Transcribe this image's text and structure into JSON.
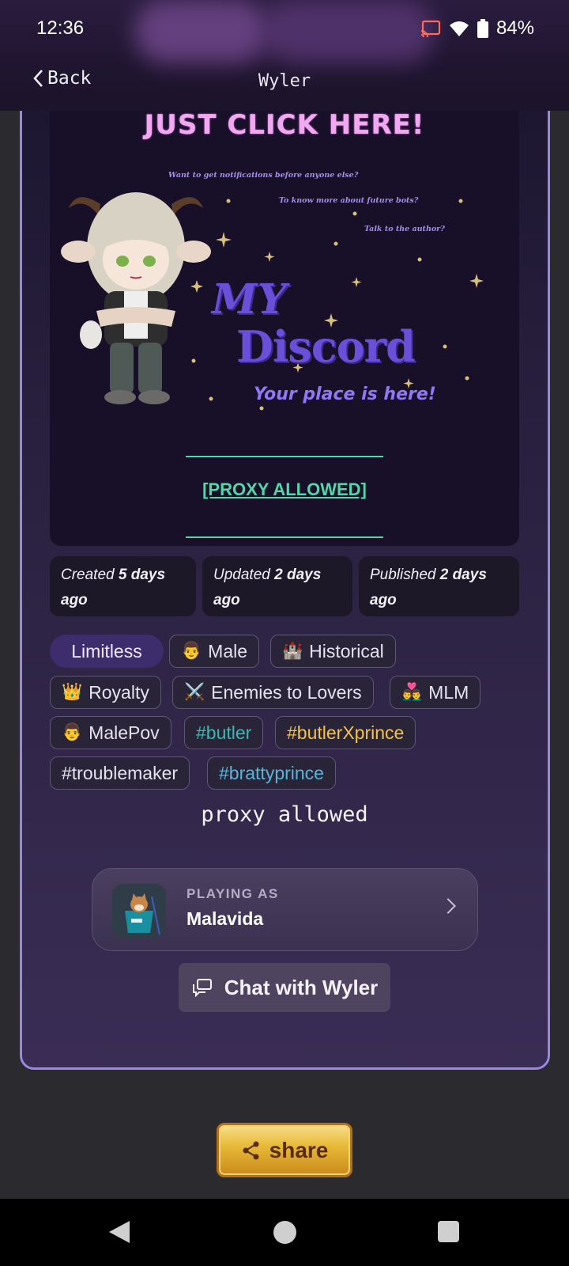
{
  "status_bar": {
    "time": "12:36",
    "battery": "84%"
  },
  "header": {
    "back_label": "Back",
    "title": "Wyler"
  },
  "banner": {
    "headline": "JUST CLICK HERE!",
    "notes": [
      "Want to get notifications before anyone else?",
      "To know more about future bots?",
      "Talk to the author?"
    ],
    "discord_my": "MY",
    "discord_word": "Discord",
    "discord_tag": "Your place is here!",
    "proxy_link": "[PROXY ALLOWED]"
  },
  "meta": [
    {
      "prefix": "Created",
      "value": "5 days",
      "suffix": "ago"
    },
    {
      "prefix": "Updated",
      "value": "2 days",
      "suffix": "ago"
    },
    {
      "prefix": "Published",
      "value": "2 days",
      "suffix": "ago"
    }
  ],
  "tags": {
    "limitless": "Limitless",
    "male": "Male",
    "historical": "Historical",
    "royalty": "Royalty",
    "enemies_to_lovers": "Enemies to Lovers",
    "mlm": "MLM",
    "malepov": "MalePov",
    "butler": "#butler",
    "butlerxprince": "#butlerXprince",
    "troublemaker": "#troublemaker",
    "brattyprince": "#brattyprince"
  },
  "tag_emojis": {
    "male": "👨",
    "historical": "🏰",
    "royalty": "👑",
    "enemies_to_lovers": "⚔️",
    "mlm": "👨‍❤️‍👨",
    "malepov": "👨"
  },
  "caption": "proxy allowed",
  "persona": {
    "label": "PLAYING AS",
    "name": "Malavida"
  },
  "chat_button": "Chat with Wyler",
  "share_button": "share",
  "colors": {
    "accent_border": "#9b86e0",
    "proxy_green": "#52d8a8",
    "share_gold": "#e8bb3a"
  }
}
